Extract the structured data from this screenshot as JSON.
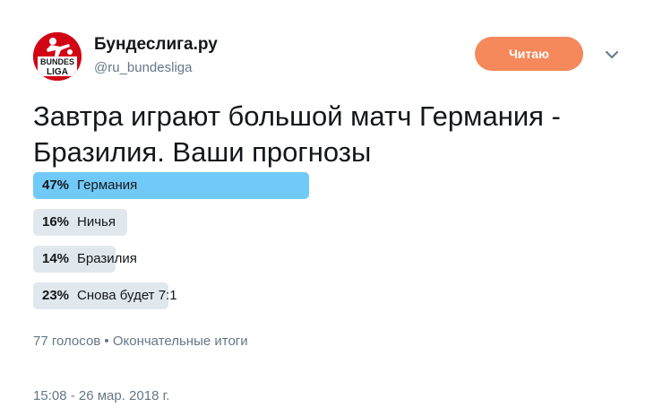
{
  "account": {
    "name": "Бундеслига.ру",
    "handle": "@ru_bundesliga",
    "logo_text_top": "BUNDES",
    "logo_text_bottom": "LIGA",
    "logo_color": "#d20515"
  },
  "follow_button": {
    "label": "Читаю",
    "color": "#f5895b"
  },
  "menu_icon": "chevron-down-icon",
  "tweet": {
    "text": "Завтра играют большой матч Германия - Бразилия. Ваши прогнозы"
  },
  "poll": {
    "winner_color": "#71c9f8",
    "bar_color": "#e1e8ed",
    "options": [
      {
        "percent_label": "47%",
        "percent": 47,
        "label": "Германия",
        "winner": true
      },
      {
        "percent_label": "16%",
        "percent": 16,
        "label": "Ничья",
        "winner": false
      },
      {
        "percent_label": "14%",
        "percent": 14,
        "label": "Бразилия",
        "winner": false
      },
      {
        "percent_label": "23%",
        "percent": 23,
        "label": "Снова будет 7:1",
        "winner": false
      }
    ],
    "summary": "77 голосов • Окончательные итоги"
  },
  "timestamp": "15:08 - 26 мар. 2018 г."
}
